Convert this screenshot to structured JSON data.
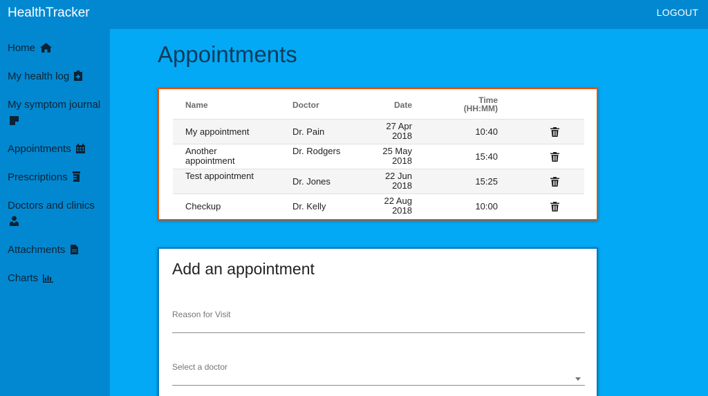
{
  "app": {
    "title": "HealthTracker",
    "logout_label": "LOGOUT"
  },
  "sidebar": {
    "items": [
      {
        "label": "Home",
        "icon": "home-icon"
      },
      {
        "label": "My health log",
        "icon": "clipboard-plus-icon"
      },
      {
        "label": "My symptom journal",
        "icon": "sticky-note-icon"
      },
      {
        "label": "Appointments",
        "icon": "calendar-icon"
      },
      {
        "label": "Prescriptions",
        "icon": "prescription-bottle-icon"
      },
      {
        "label": "Doctors and clinics",
        "icon": "user-doctor-icon"
      },
      {
        "label": "Attachments",
        "icon": "file-icon"
      },
      {
        "label": "Charts",
        "icon": "bar-chart-icon"
      }
    ]
  },
  "main": {
    "title": "Appointments",
    "table": {
      "headers": {
        "name": "Name",
        "doctor": "Doctor",
        "date": "Date",
        "time": "Time",
        "time_unit": "(HH:MM)"
      },
      "rows": [
        {
          "name": "My appointment",
          "doctor": "Dr. Pain",
          "date_day": "27 Apr",
          "date_year": "2018",
          "time": "10:40"
        },
        {
          "name": "Another appointment",
          "doctor": "Dr. Rodgers",
          "date_day": "25 May",
          "date_year": "2018",
          "time": "15:40"
        },
        {
          "name": "Test appointment",
          "doctor": "Dr. Jones",
          "date_day": "22 Jun",
          "date_year": "2018",
          "time": "15:25"
        },
        {
          "name": "Checkup",
          "doctor": "Dr. Kelly",
          "date_day": "22 Aug",
          "date_year": "2018",
          "time": "10:00"
        }
      ],
      "delete_icon": "trash-icon"
    },
    "form": {
      "title": "Add an appointment",
      "reason_label": "Reason for Visit",
      "doctor_label": "Select a doctor"
    }
  },
  "colors": {
    "header": "#0288d1",
    "background": "#03a9f4",
    "table_border": "#e65100",
    "form_border": "#0277bd"
  }
}
